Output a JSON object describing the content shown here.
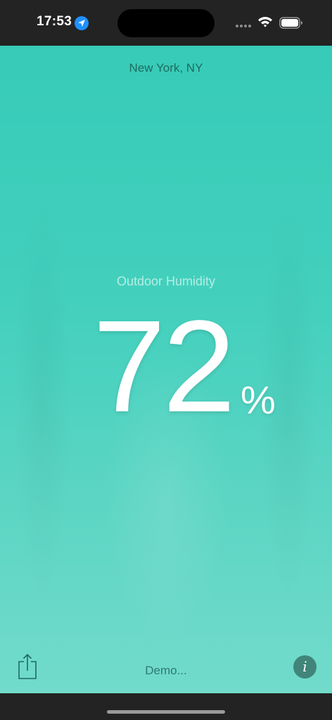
{
  "status_bar": {
    "time": "17:53",
    "icons": [
      "location-arrow-icon",
      "signal-icon",
      "wifi-icon",
      "battery-icon"
    ]
  },
  "header": {
    "city": "New York, NY"
  },
  "main": {
    "metric_label": "Outdoor Humidity",
    "value": "72",
    "unit": "%"
  },
  "footer": {
    "status_text": "Demo...",
    "share_icon": "share-icon",
    "info_label": "i"
  },
  "colors": {
    "background_top": "#37cbb8",
    "background_bottom": "#72dbcb",
    "info_button": "#41857a",
    "text_dark": "#1f6b60"
  }
}
